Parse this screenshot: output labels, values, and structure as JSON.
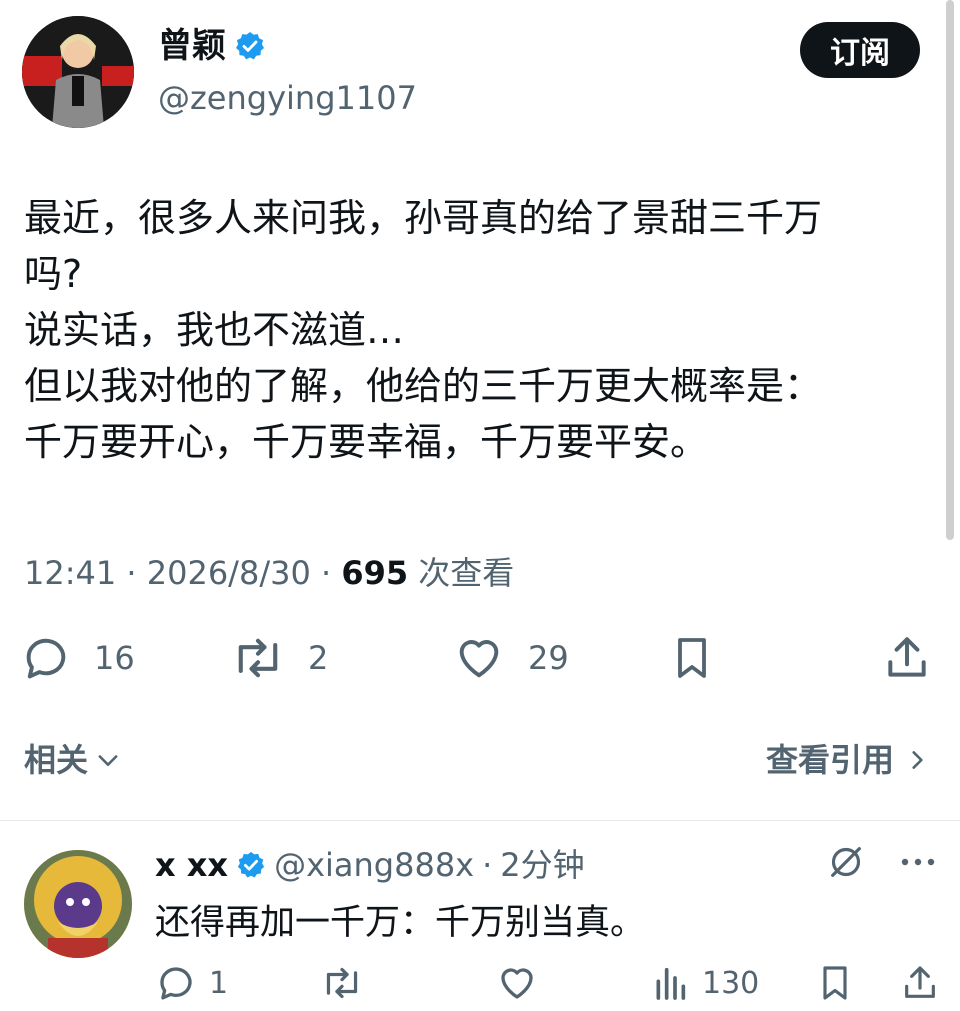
{
  "colors": {
    "text": "#0f1419",
    "muted": "#536471",
    "verified": "#1d9bf0",
    "button_bg": "#0f1419"
  },
  "post": {
    "author_name": "曾颖",
    "author_handle": "@zengying1107",
    "subscribe_label": "订阅",
    "text": "最近，很多人来问我，孙哥真的给了景甜三千万\n吗?\n说实话，我也不滋道…\n但以我对他的了解，他给的三千万更大概率是：\n千万要开心，千万要幸福，千万要平安。",
    "time": "12:41",
    "date": "2026/8/30",
    "views_count": "695",
    "views_label": "次查看",
    "replies": "16",
    "reposts": "2",
    "likes": "29"
  },
  "related_label": "相关",
  "view_quotes_label": "查看引用",
  "reply": {
    "author_name": "x xx",
    "author_handle": "@xiang888x",
    "time_ago": "2分钟",
    "text": "还得再加一千万：千万别当真。",
    "replies": "1",
    "views": "130"
  }
}
